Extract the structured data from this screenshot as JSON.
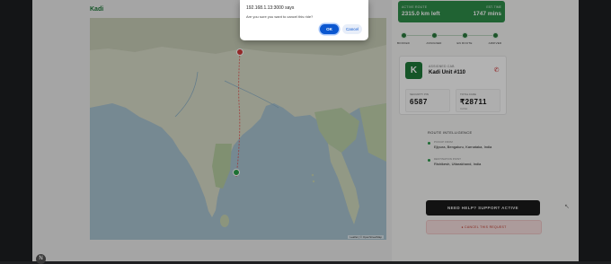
{
  "brand": "Kadi",
  "route": {
    "active_label": "ACTIVE ROUTE",
    "distance": "2315.0 km left",
    "eta_label": "EST. TIME",
    "eta": "1747 mins"
  },
  "progress_steps": [
    "BOOKED",
    "ASSIGNED",
    "EN ROUTE",
    "ARRIVED"
  ],
  "driver": {
    "avatar_letter": "K",
    "sub_label": "ASSIGNED CAB",
    "name": "Kadi Unit #110",
    "boxes": [
      {
        "label": "SECURITY PIN",
        "value": "6587",
        "sub": ""
      },
      {
        "label": "TOTAL FARE",
        "value": "₹28711",
        "sub": "CASH"
      }
    ]
  },
  "route_intel": {
    "title": "ROUTE INTELLIGENCE",
    "pickup_label": "PICKUP FROM",
    "pickup": "Ejipura, Bengaluru, Karnataka, India",
    "destination_label": "DESTINATION POINT",
    "destination": "Rishikesh, Uttarakhand, India"
  },
  "support_button": "NEED HELP? SUPPORT ACTIVE",
  "cancel_button": "● CANCEL THIS REQUEST",
  "map_credit": "Leaflet | © OpenStreetMap",
  "dialog": {
    "title": "192.168.1.13:3000 says",
    "message": "Are you sure you want to cancel this ride?",
    "ok": "OK",
    "cancel": "Cancel"
  },
  "colors": {
    "accent": "#2f8f4a",
    "danger": "#d0393b",
    "dialog_ok": "#0b57d0"
  }
}
